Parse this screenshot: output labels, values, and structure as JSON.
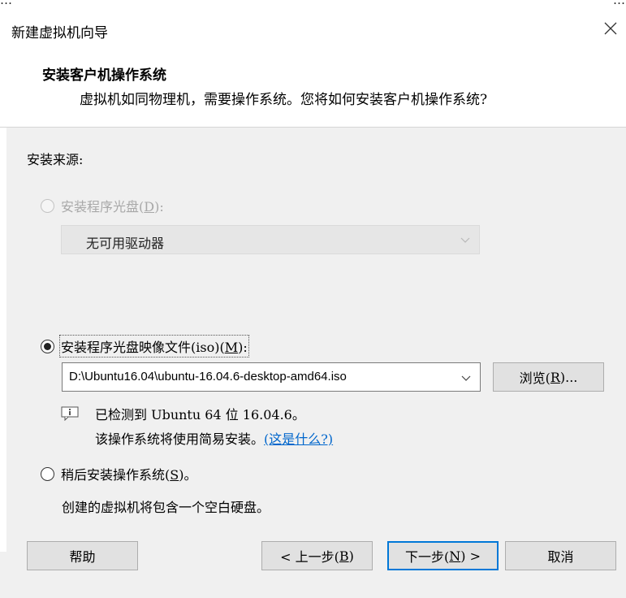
{
  "background_fragments": {
    "left": "…",
    "right": "…"
  },
  "window": {
    "title": "新建虚拟机向导",
    "close_label": "×"
  },
  "header": {
    "title": "安装客户机操作系统",
    "subtitle": "虚拟机如同物理机，需要操作系统。您将如何安装客户机操作系统?"
  },
  "source": {
    "label": "安装来源:",
    "disc_option": {
      "text": "安装程序光盘(",
      "key": "D",
      "tail": "):",
      "selected": false,
      "enabled": false
    },
    "disc_drive": {
      "value": "无可用驱动器"
    },
    "iso_option": {
      "text": "安装程序光盘映像文件(iso)(",
      "key": "M",
      "tail": "):",
      "selected": true,
      "enabled": true
    },
    "iso_path": {
      "value": "D:\\Ubuntu16.04\\ubuntu-16.04.6-desktop-amd64.iso"
    },
    "browse_button": {
      "text": "浏览(",
      "key": "R",
      "tail": ")..."
    },
    "detected": {
      "line1": "已检测到 Ubuntu 64 位 16.04.6。",
      "line2": "该操作系统将使用简易安装。",
      "link": "(这是什么?)"
    },
    "later_option": {
      "text": "稍后安装操作系统(",
      "key": "S",
      "tail": ")。",
      "selected": false,
      "enabled": true
    },
    "later_note": "创建的虚拟机将包含一个空白硬盘。"
  },
  "footer": {
    "help": "帮助",
    "back": {
      "text": "< 上一步(",
      "key": "B",
      "tail": ")"
    },
    "next": {
      "text": "下一步(",
      "key": "N",
      "tail": ") >"
    },
    "cancel": "取消"
  },
  "colors": {
    "accent": "#0078d7",
    "link": "#0066cc",
    "panel": "#f0f0f0"
  },
  "icons": [
    "close-icon",
    "chevron-down-icon",
    "info-icon"
  ]
}
